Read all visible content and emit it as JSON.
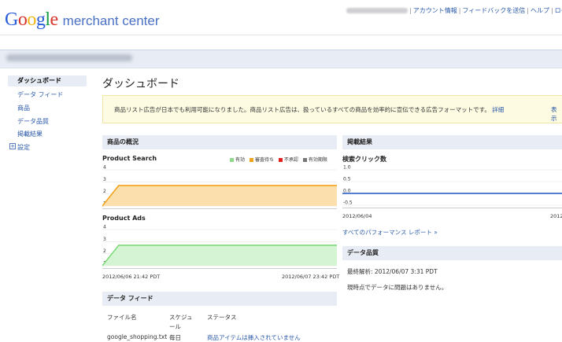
{
  "header": {
    "logo_google": [
      "G",
      "o",
      "o",
      "g",
      "l",
      "e"
    ],
    "logo_suffix": "merchant center",
    "links": [
      "アカウント情報",
      "フィードバックを送信",
      "ヘルプ",
      "ログ"
    ]
  },
  "sidebar": {
    "items": [
      {
        "label": "ダッシュボード",
        "active": true
      },
      {
        "label": "データ フィード"
      },
      {
        "label": "商品"
      },
      {
        "label": "データ品質"
      },
      {
        "label": "掲載結果"
      },
      {
        "label": "設定",
        "expand": "+"
      }
    ]
  },
  "page": {
    "title": "ダッシュボード",
    "notice": "商品リスト広告が日本でも利用可能になりました。商品リスト広告は、扱っているすべての商品を効率的に宣伝できる広告フォーマットです。",
    "notice_link": "詳細",
    "notice_more": "表示"
  },
  "overview": {
    "section_title": "商品の概況",
    "legend": [
      {
        "label": "有効",
        "color": "#8fd98a"
      },
      {
        "label": "審査待ち",
        "color": "#f2a31b"
      },
      {
        "label": "不承認",
        "color": "#e02020"
      },
      {
        "label": "有効期限",
        "color": "#777777"
      }
    ],
    "date_start": "2012/06/06 21:42 PDT",
    "date_end": "2012/06/07 23:42 PDT"
  },
  "chart_data": [
    {
      "type": "area",
      "title": "Product Search",
      "ylim": [
        1,
        4
      ],
      "yticks": [
        "4",
        "3",
        "2",
        "1"
      ],
      "color": "#f2a31b",
      "fill": "#fbdfad",
      "x": [
        0,
        0.07,
        1
      ],
      "values": [
        1,
        2.7,
        2.7
      ]
    },
    {
      "type": "area",
      "title": "Product Ads",
      "ylim": [
        1,
        4
      ],
      "yticks": [
        "4",
        "3",
        "2",
        "1"
      ],
      "color": "#7fd97c",
      "fill": "#d5f4d3",
      "x": [
        0,
        0.07,
        1
      ],
      "values": [
        1,
        2.7,
        2.7
      ]
    },
    {
      "type": "line",
      "title": "検索クリック数",
      "ylim": [
        -0.5,
        1.0
      ],
      "yticks": [
        "1.0",
        "0.5",
        "0.0",
        "-0.5"
      ],
      "color": "#3d6cc9",
      "x": [
        0,
        1
      ],
      "values": [
        0,
        0
      ]
    }
  ],
  "performance": {
    "section_title": "掲載結果",
    "x_start": "2012/06/04",
    "x_end": "2012",
    "report_link": "すべてのパフォーマンス レポート »"
  },
  "quality": {
    "section_title": "データ品質",
    "last_analysis": "最終解析: 2012/06/07 3:31 PDT",
    "message": "現時点でデータに問題はありません。"
  },
  "feed": {
    "section_title": "データ フィード",
    "columns": [
      "ファイル名",
      "スケジュール",
      "ステータス"
    ],
    "row": [
      "google_shopping.txt",
      "毎日",
      "商品アイテムは挿入されていません"
    ]
  }
}
